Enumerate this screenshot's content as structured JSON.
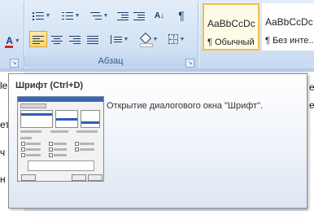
{
  "paragraph_group": {
    "label": "Абзац"
  },
  "styles": [
    {
      "sample": "AaBbCcDc",
      "name": "¶ Обычный",
      "selected": true
    },
    {
      "sample": "AaBbCcDc",
      "name": "¶ Без инте...",
      "selected": false
    }
  ],
  "doc_fragments": [
    "ч",
    "н"
  ],
  "doc_left_partial": [
    "le",
    "ет",
    "ч",
    "н"
  ],
  "doc_right_partial": [
    "е",
    "е"
  ],
  "tooltip": {
    "title": "Шрифт (Ctrl+D)",
    "description": "Открытие диалогового окна \"Шрифт\"."
  },
  "icons": {
    "font_color": "A",
    "show_marks": "¶",
    "sort": "A↓"
  }
}
